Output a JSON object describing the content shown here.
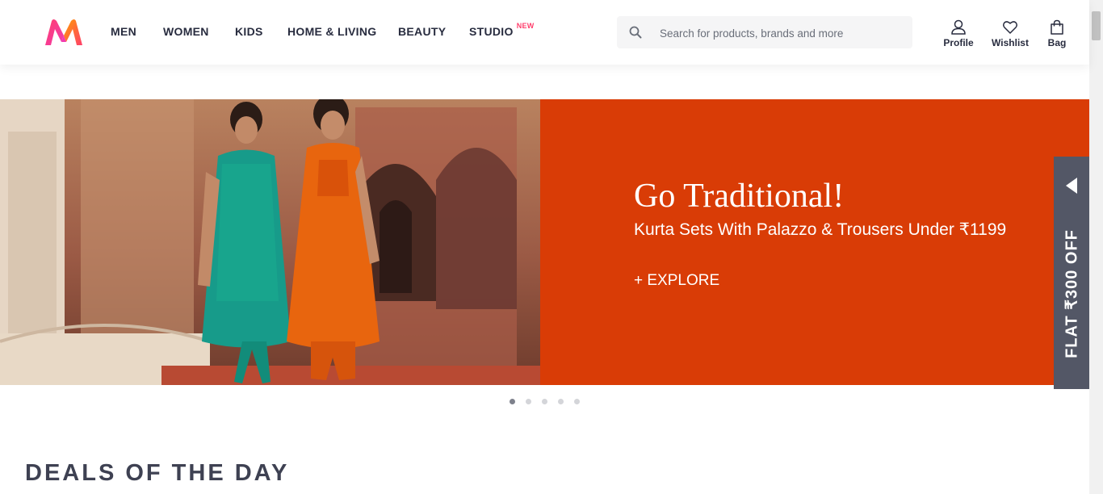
{
  "header": {
    "nav": [
      {
        "label": "MEN"
      },
      {
        "label": "WOMEN"
      },
      {
        "label": "KIDS"
      },
      {
        "label": "HOME & LIVING"
      },
      {
        "label": "BEAUTY"
      },
      {
        "label": "STUDIO",
        "badge": "NEW"
      }
    ],
    "search": {
      "placeholder": "Search for products, brands and more",
      "value": ""
    },
    "actions": [
      {
        "label": "Profile",
        "icon": "profile-icon"
      },
      {
        "label": "Wishlist",
        "icon": "heart-icon"
      },
      {
        "label": "Bag",
        "icon": "bag-icon"
      }
    ]
  },
  "banner": {
    "title": "Go Traditional!",
    "subtitle": "Kurta Sets With Palazzo & Trousers Under ₹1199",
    "cta": "+ EXPLORE",
    "background_color": "#d93c06"
  },
  "offer_tab": {
    "text": "FLAT ₹300 OFF",
    "icon": "arrow-left-icon"
  },
  "carousel": {
    "count": 5,
    "active_index": 0
  },
  "deals": {
    "title": "DEALS OF THE DAY"
  },
  "colors": {
    "brand_pink": "#ff3f6c",
    "text": "#282c3f",
    "offer_tab": "#535766"
  }
}
